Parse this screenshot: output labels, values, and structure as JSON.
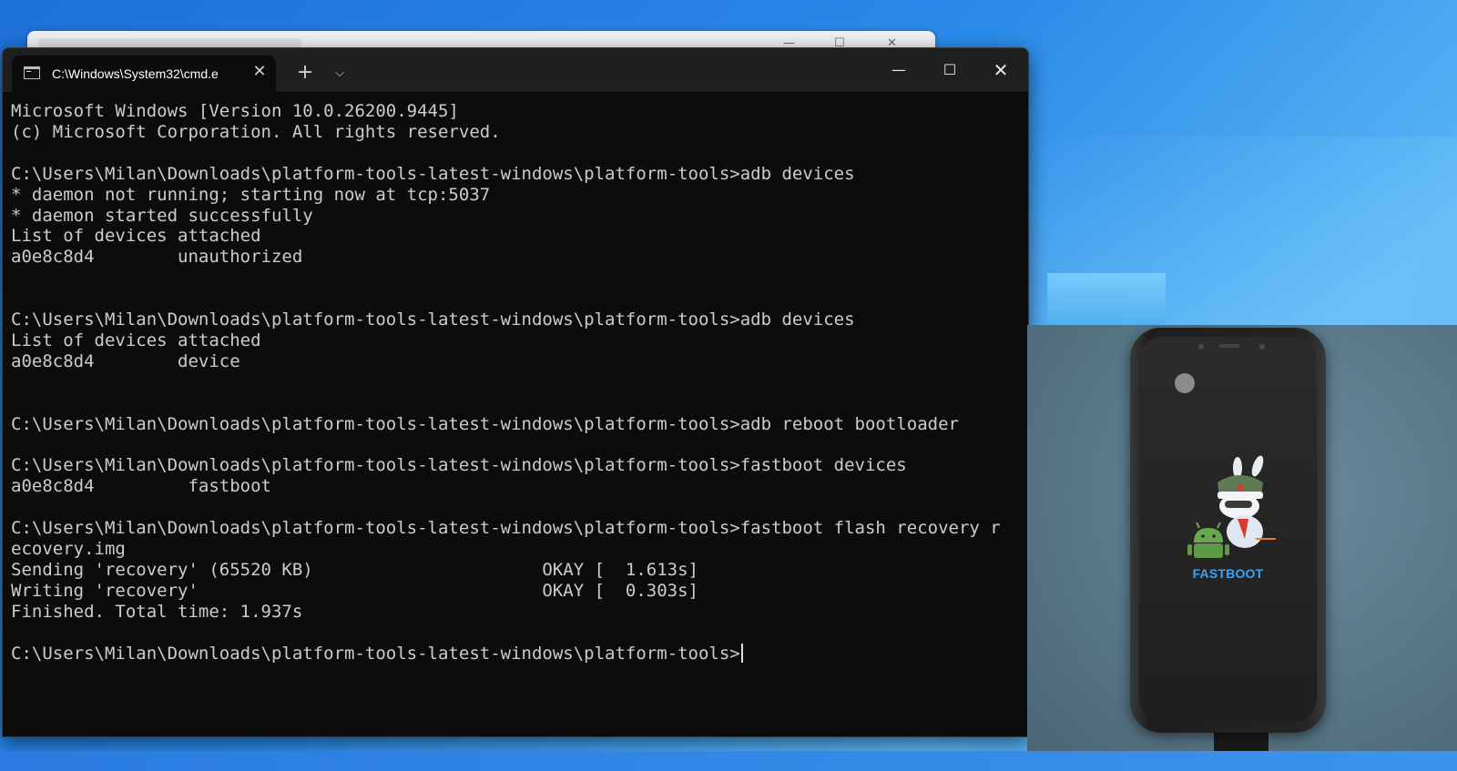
{
  "window": {
    "tab_title": "C:\\Windows\\System32\\cmd.e",
    "close_tab_glyph": "✕",
    "new_tab_glyph": "+",
    "dropdown_glyph": "⌵",
    "minimize_glyph": "—",
    "maximize_glyph": "☐",
    "close_glyph": "✕"
  },
  "console": {
    "lines": [
      "Microsoft Windows [Version 10.0.26200.9445]",
      "(c) Microsoft Corporation. All rights reserved.",
      "",
      "C:\\Users\\Milan\\Downloads\\platform-tools-latest-windows\\platform-tools>adb devices",
      "* daemon not running; starting now at tcp:5037",
      "* daemon started successfully",
      "List of devices attached",
      "a0e8c8d4        unauthorized",
      "",
      "",
      "C:\\Users\\Milan\\Downloads\\platform-tools-latest-windows\\platform-tools>adb devices",
      "List of devices attached",
      "a0e8c8d4        device",
      "",
      "",
      "C:\\Users\\Milan\\Downloads\\platform-tools-latest-windows\\platform-tools>adb reboot bootloader",
      "",
      "C:\\Users\\Milan\\Downloads\\platform-tools-latest-windows\\platform-tools>fastboot devices",
      "a0e8c8d4         fastboot",
      "",
      "C:\\Users\\Milan\\Downloads\\platform-tools-latest-windows\\platform-tools>fastboot flash recovery r",
      "ecovery.img",
      "Sending 'recovery' (65520 KB)                      OKAY [  1.613s]",
      "Writing 'recovery'                                 OKAY [  0.303s]",
      "Finished. Total time: 1.937s",
      "",
      "C:\\Users\\Milan\\Downloads\\platform-tools-latest-windows\\platform-tools>"
    ]
  },
  "phone": {
    "screen_label": "FASTBOOT"
  },
  "colors": {
    "console_bg": "#0c0c0c",
    "console_text": "#cccccc",
    "fastboot_blue": "#3fa2f0"
  }
}
